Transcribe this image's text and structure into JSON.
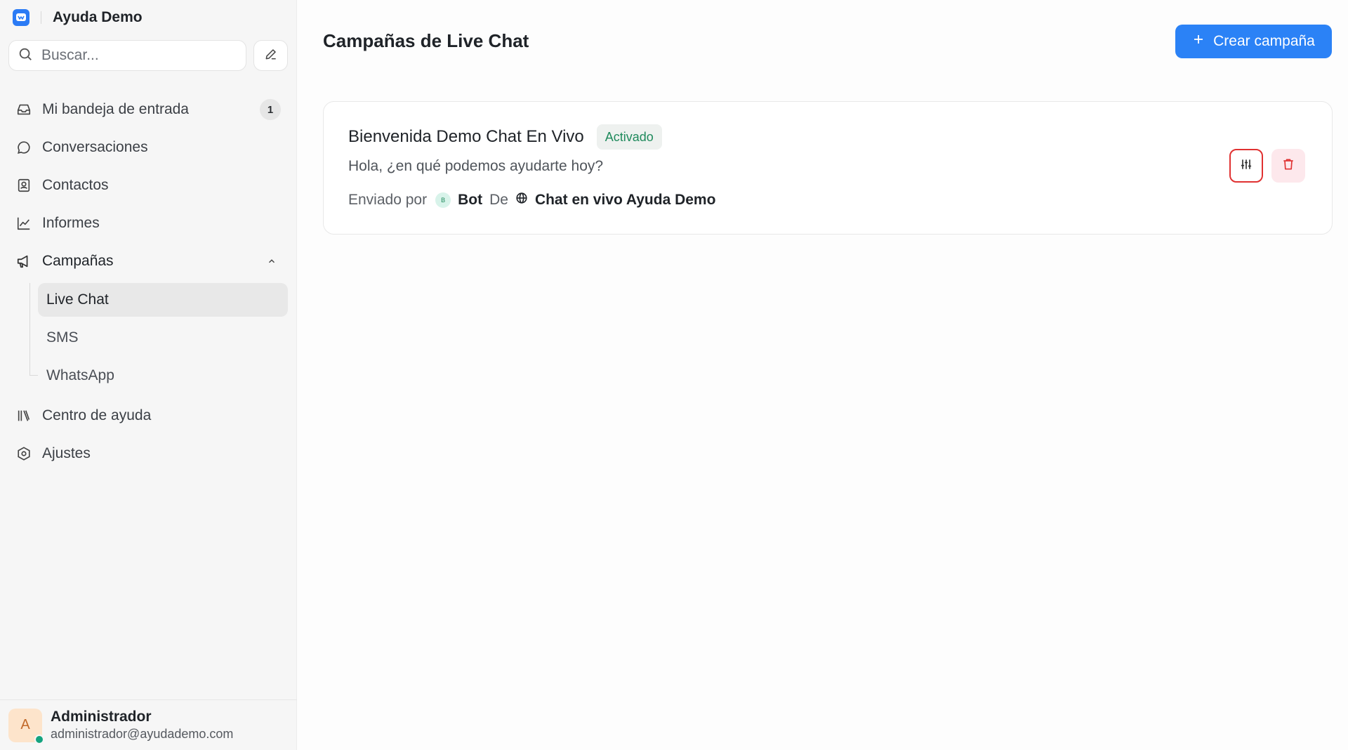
{
  "brand": {
    "name": "Ayuda Demo"
  },
  "search": {
    "placeholder": "Buscar..."
  },
  "nav": {
    "inbox": {
      "label": "Mi bandeja de entrada",
      "badge": "1"
    },
    "conversations": "Conversaciones",
    "contacts": "Contactos",
    "reports": "Informes",
    "campaigns": "Campañas",
    "campaign_items": [
      "Live Chat",
      "SMS",
      "WhatsApp"
    ],
    "help_center": "Centro de ayuda",
    "settings": "Ajustes"
  },
  "profile": {
    "initial": "A",
    "name": "Administrador",
    "email": "administrador@ayudademo.com"
  },
  "main": {
    "title": "Campañas de Live Chat",
    "create_label": "Crear campaña"
  },
  "campaign": {
    "title": "Bienvenida Demo Chat En Vivo",
    "status": "Activado",
    "message": "Hola, ¿en qué podemos ayudarte hoy?",
    "sent_by_label": "Enviado por",
    "bot_initial": "B",
    "bot_name": "Bot",
    "from_label": "De",
    "inbox_name": "Chat en vivo Ayuda Demo"
  },
  "colors": {
    "accent": "#2b82f6",
    "status_green": "#1f8a5c",
    "delete_red": "#e03131"
  }
}
